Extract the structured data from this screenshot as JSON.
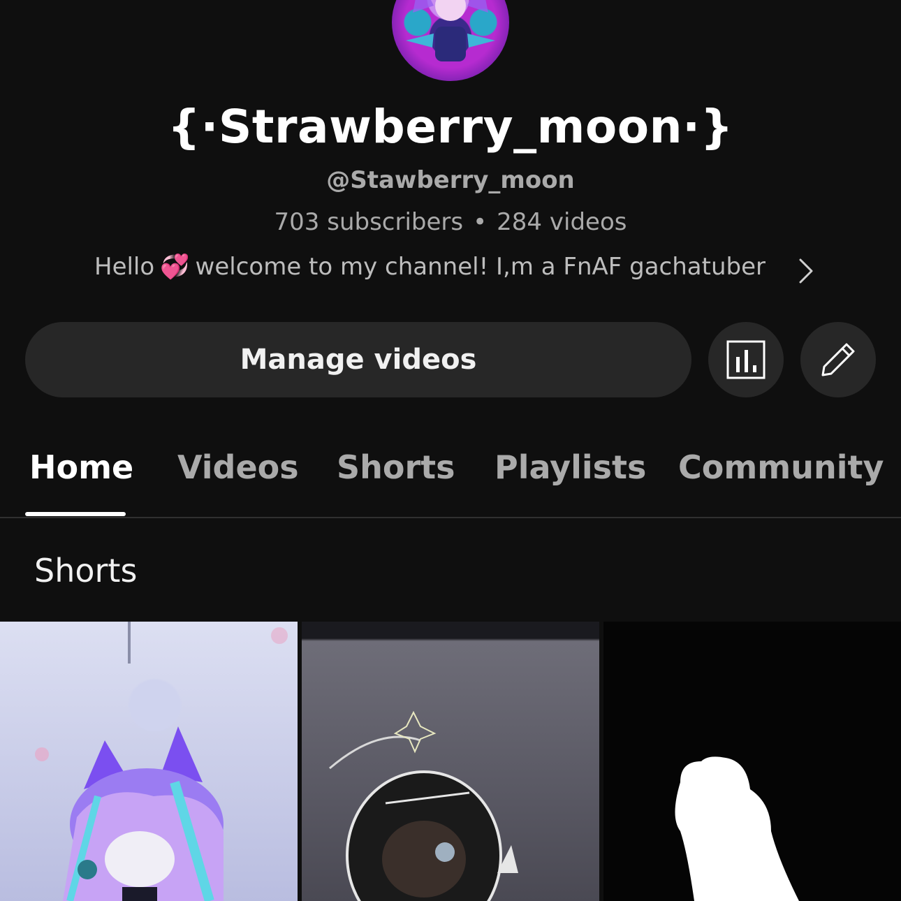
{
  "channel": {
    "title": "{·Strawberry_moon·}",
    "handle": "@Stawberry_moon",
    "subscribers": "703 subscribers",
    "separator": "•",
    "videos": "284 videos",
    "description_hello": "Hello",
    "description_emoji": "💞",
    "description_rest": "welcome to my channel! I,m a FnAF gachatuber"
  },
  "actions": {
    "manage_label": "Manage videos",
    "analytics_icon": "analytics-icon",
    "edit_icon": "pencil-icon"
  },
  "tabs": [
    {
      "label": "Home",
      "active": true
    },
    {
      "label": "Videos",
      "active": false
    },
    {
      "label": "Shorts",
      "active": false
    },
    {
      "label": "Playlists",
      "active": false
    },
    {
      "label": "Community",
      "active": false
    }
  ],
  "section": {
    "title": "Shorts"
  },
  "colors": {
    "background": "#0f0f0f",
    "button": "#272727",
    "secondary_text": "#aaaaaa"
  }
}
